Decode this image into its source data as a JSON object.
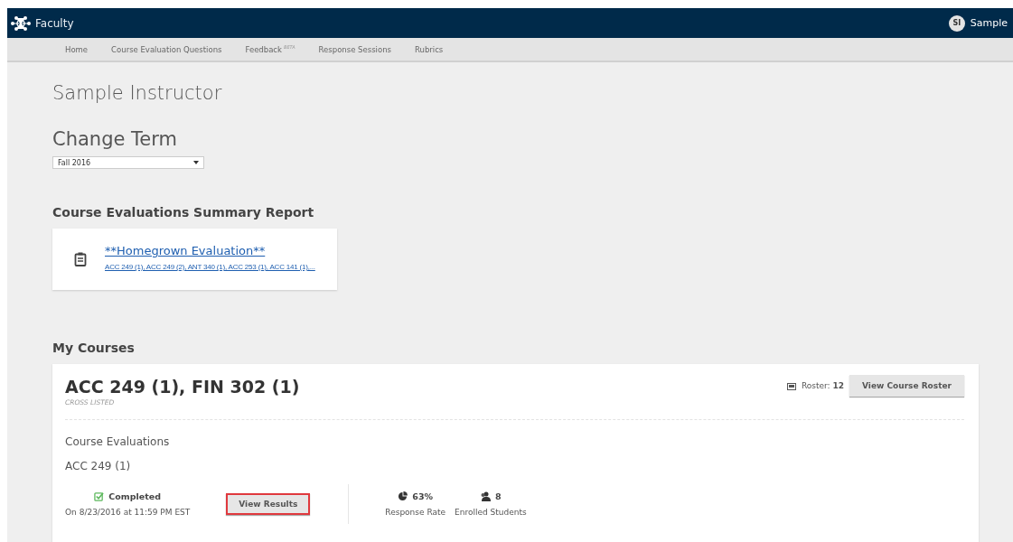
{
  "app": {
    "title": "Faculty",
    "user": {
      "initials": "SI",
      "name": "Sample"
    }
  },
  "nav": [
    {
      "label": "Home"
    },
    {
      "label": "Course Evaluation Questions"
    },
    {
      "label": "Feedback",
      "badge": "BETA"
    },
    {
      "label": "Response Sessions"
    },
    {
      "label": "Rubrics"
    }
  ],
  "instructor": "Sample Instructor",
  "change_term": {
    "heading": "Change Term",
    "value": "Fall 2016"
  },
  "summary_report": {
    "heading": "Course Evaluations Summary Report",
    "evaluation": {
      "title": "**Homegrown Evaluation**",
      "courses": "ACC 249 (1), ACC 249 (2), ANT 340 (1), ACC 253 (1), ACC 141 (1),..."
    }
  },
  "my_courses": {
    "heading": "My Courses",
    "courses": [
      {
        "title": "ACC 249 (1), FIN 302 (1)",
        "subtitle": "CROSS LISTED",
        "roster_label": "Roster:",
        "roster_count": "12",
        "roster_button": "View Course Roster",
        "section_heading": "Course Evaluations",
        "evaluations": [
          {
            "course": "ACC 249 (1)",
            "status": "Completed",
            "completed": true,
            "date": "On 8/23/2016 at 11:59 PM EST",
            "button": {
              "label": "View Results",
              "highlighted": true
            },
            "response_rate": "63%",
            "response_rate_label": "Response Rate",
            "enrolled": "8",
            "enrolled_label": "Enrolled Students"
          }
        ]
      }
    ]
  }
}
